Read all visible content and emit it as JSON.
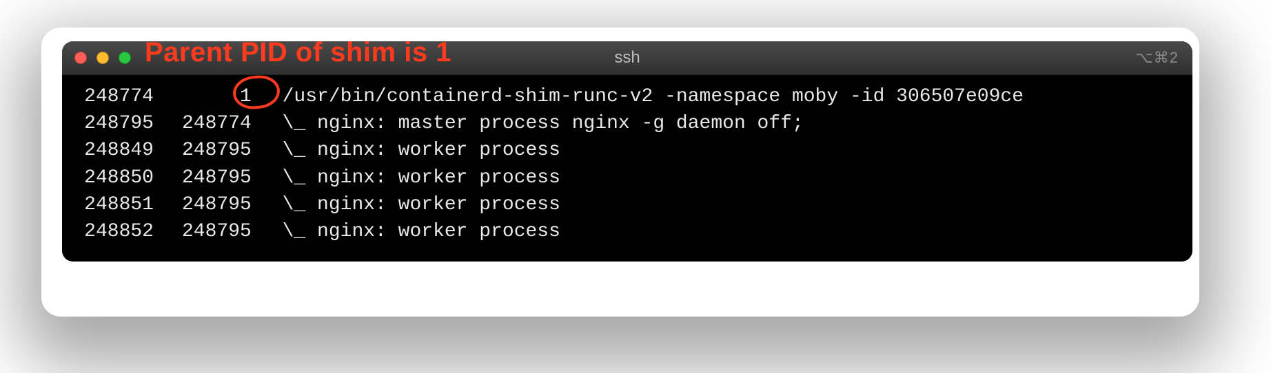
{
  "annotation": {
    "text": "Parent PID of shim is 1"
  },
  "window": {
    "title": "ssh",
    "shortcut": "⌥⌘2"
  },
  "rows": [
    {
      "pid": "248774",
      "ppid": "1",
      "indent": 0,
      "cmd": "/usr/bin/containerd-shim-runc-v2 -namespace moby -id 306507e09ce"
    },
    {
      "pid": "248795",
      "ppid": "248774",
      "indent": 1,
      "cmd": "nginx: master process nginx -g daemon off;"
    },
    {
      "pid": "248849",
      "ppid": "248795",
      "indent": 2,
      "cmd": "nginx: worker process"
    },
    {
      "pid": "248850",
      "ppid": "248795",
      "indent": 2,
      "cmd": "nginx: worker process"
    },
    {
      "pid": "248851",
      "ppid": "248795",
      "indent": 2,
      "cmd": "nginx: worker process"
    },
    {
      "pid": "248852",
      "ppid": "248795",
      "indent": 2,
      "cmd": "nginx: worker process"
    }
  ],
  "tree_prefixes": [
    "",
    " \\_ ",
    "     \\_ "
  ]
}
